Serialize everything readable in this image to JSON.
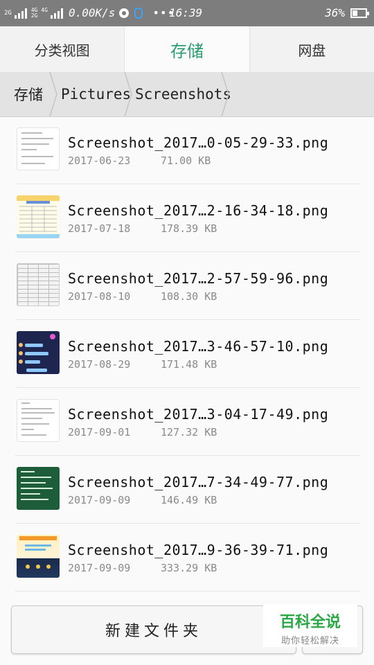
{
  "status_bar": {
    "sim": "2G",
    "net_top": "4G 4G",
    "net_bottom": "2G",
    "speed": "0.00K/s",
    "overflow": "•••",
    "time": "16:39",
    "battery_pct": "36%",
    "battery_level": 0.36
  },
  "tabs": [
    {
      "label": "分类视图"
    },
    {
      "label": "存储"
    },
    {
      "label": "网盘"
    }
  ],
  "active_tab": 1,
  "breadcrumb": [
    "存储",
    "Pictures",
    "Screenshots"
  ],
  "files": [
    {
      "name": "Screenshot_2017…0-05-29-33.png",
      "date": "2017-06-23",
      "size": "71.00 KB",
      "thumb": "document"
    },
    {
      "name": "Screenshot_2017…2-16-34-18.png",
      "date": "2017-07-18",
      "size": "178.39 KB",
      "thumb": "table"
    },
    {
      "name": "Screenshot_2017…2-57-59-96.png",
      "date": "2017-08-10",
      "size": "108.30 KB",
      "thumb": "grid"
    },
    {
      "name": "Screenshot_2017…3-46-57-10.png",
      "date": "2017-08-29",
      "size": "171.48 KB",
      "thumb": "chat"
    },
    {
      "name": "Screenshot_2017…3-04-17-49.png",
      "date": "2017-09-01",
      "size": "127.32 KB",
      "thumb": "document"
    },
    {
      "name": "Screenshot_2017…7-34-49-77.png",
      "date": "2017-09-09",
      "size": "146.49 KB",
      "thumb": "green-board"
    },
    {
      "name": "Screenshot_2017…9-36-39-71.png",
      "date": "2017-09-09",
      "size": "333.29 KB",
      "thumb": "game"
    }
  ],
  "bottom": {
    "new_folder": "新建文件夹"
  },
  "watermark": {
    "title": "百科全说",
    "subtitle": "助你轻松解决"
  },
  "colors": {
    "accent": "#2a9d6e",
    "status_bar": "#7d7d7d",
    "watermark": "#2aa845"
  }
}
